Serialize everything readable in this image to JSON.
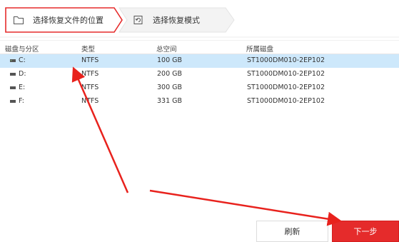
{
  "steps": [
    {
      "label": "选择恢复文件的位置",
      "icon": "folder-icon",
      "active": true
    },
    {
      "label": "选择恢复模式",
      "icon": "recovery-mode-icon",
      "active": false
    }
  ],
  "table": {
    "headers": [
      "磁盘与分区",
      "类型",
      "总空间",
      "所属磁盘"
    ],
    "rows": [
      {
        "name": "C:",
        "type": "NTFS",
        "size": "100 GB",
        "disk": "ST1000DM010-2EP102",
        "selected": true
      },
      {
        "name": "D:",
        "type": "NTFS",
        "size": "200 GB",
        "disk": "ST1000DM010-2EP102",
        "selected": false
      },
      {
        "name": "E:",
        "type": "NTFS",
        "size": "300 GB",
        "disk": "ST1000DM010-2EP102",
        "selected": false
      },
      {
        "name": "F:",
        "type": "NTFS",
        "size": "331 GB",
        "disk": "ST1000DM010-2EP102",
        "selected": false
      }
    ]
  },
  "buttons": {
    "refresh": "刷新",
    "next": "下一步"
  },
  "colors": {
    "accent": "#e52b2b",
    "selection": "#cde8fb",
    "annotation": "#e8221d"
  }
}
